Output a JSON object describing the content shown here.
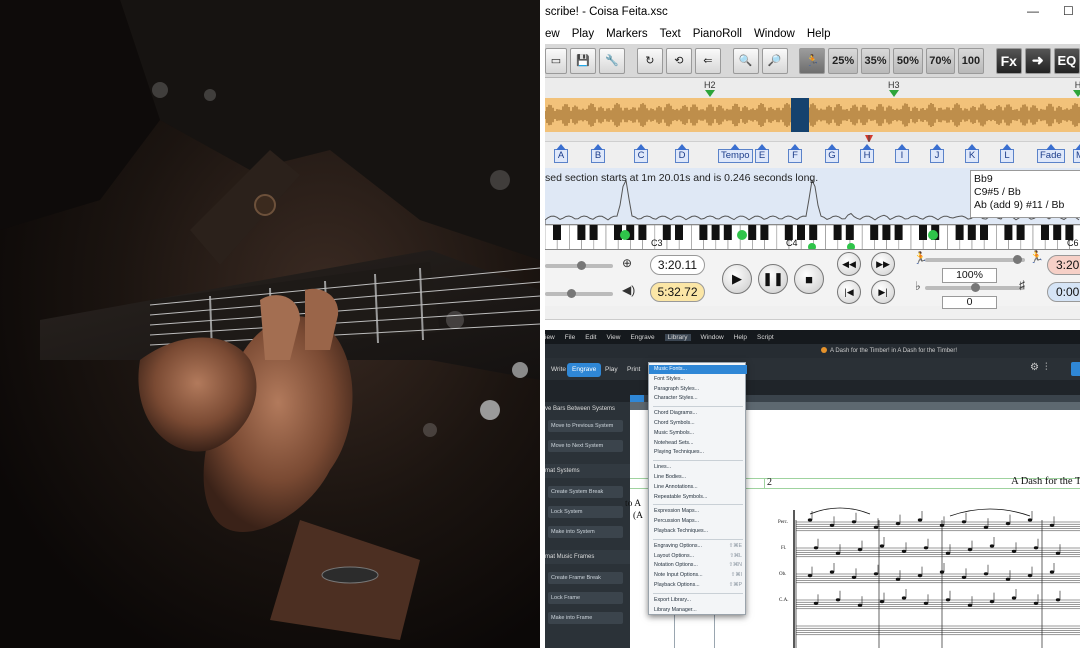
{
  "transcribe": {
    "title": "scribe! - Coisa Feita.xsc",
    "window_controls": {
      "minimize": "—",
      "maximize": "☐"
    },
    "menu": [
      "ew",
      "Play",
      "Markers",
      "Text",
      "PianoRoll",
      "Window",
      "Help"
    ],
    "toolbar": {
      "speed_buttons": [
        "25%",
        "35%",
        "50%",
        "70%",
        "100"
      ],
      "fx": "Fx",
      "eq": "EQ"
    },
    "section_markers": [
      "H2",
      "H3",
      "H"
    ],
    "letter_markers": [
      "A",
      "B",
      "C",
      "D",
      "Tempo",
      "E",
      "F",
      "G",
      "H",
      "I",
      "J",
      "K",
      "L",
      "Fade",
      "M"
    ],
    "info_text": "sed section starts at 1m 20.01s and is 0.246 seconds long.",
    "chords": [
      "Bb9",
      "C9#5 / Bb",
      "Ab (add 9) #11 / Bb"
    ],
    "piano_labels": [
      "C3",
      "C4",
      "C6"
    ],
    "time_current": "3:20.11",
    "time_total": "5:32.72",
    "speed_value": "100%",
    "pitch_value": "0",
    "time_right_1": "3:20",
    "time_right_2": "0:00",
    "icons": [
      "new-icon",
      "save-icon",
      "tune-icon",
      "loop-ab-icon",
      "loop-icon",
      "back-icon",
      "zoom-icon",
      "zoom-fit-icon",
      "runner-icon",
      "play-icon",
      "pause-icon",
      "stop-icon",
      "rewind-icon",
      "fast-forward-icon",
      "skip-start-icon",
      "skip-end-icon",
      "speaker-icon",
      "flat-icon",
      "sharp-icon"
    ]
  },
  "dorico": {
    "menu": [
      "iew",
      "File",
      "Edit",
      "View",
      "Engrave",
      "Library",
      "Window",
      "Help",
      "Script"
    ],
    "active_menu": "Library",
    "title": "A Dash for the Timber! in A Dash for the Timber!",
    "modes": [
      "Write",
      "Engrave",
      "Play",
      "Print"
    ],
    "active_mode": "Engrave",
    "panel": {
      "section1": "ve Bars Between Systems",
      "section1_buttons": [
        "Move to Previous System",
        "Move to Next System"
      ],
      "section2": "mat Systems",
      "section2_buttons": [
        "Create System Break",
        "Lock System",
        "Make into System"
      ],
      "section3": "mat Music Frames",
      "section3_buttons": [
        "Create Frame Break",
        "Lock Frame",
        "Make into Frame"
      ]
    },
    "library_menu": [
      {
        "label": "Music Fonts...",
        "shortcut": ""
      },
      {
        "label": "Font Styles...",
        "shortcut": ""
      },
      {
        "label": "Paragraph Styles...",
        "shortcut": ""
      },
      {
        "label": "Character Styles...",
        "shortcut": ""
      },
      {
        "label": "Chord Diagrams...",
        "shortcut": ""
      },
      {
        "label": "Chord Symbols...",
        "shortcut": ""
      },
      {
        "label": "Music Symbols...",
        "shortcut": ""
      },
      {
        "label": "Notehead Sets...",
        "shortcut": ""
      },
      {
        "label": "Playing Techniques...",
        "shortcut": ""
      },
      {
        "label": "Lines...",
        "shortcut": ""
      },
      {
        "label": "Line Bodies...",
        "shortcut": ""
      },
      {
        "label": "Line Annotations...",
        "shortcut": ""
      },
      {
        "label": "Repeatable Symbols...",
        "shortcut": ""
      },
      {
        "label": "Expression Maps...",
        "shortcut": ""
      },
      {
        "label": "Percussion Maps...",
        "shortcut": ""
      },
      {
        "label": "Playback Techniques...",
        "shortcut": ""
      },
      {
        "label": "Engraving Options...",
        "shortcut": "⇧⌘E"
      },
      {
        "label": "Layout Options...",
        "shortcut": "⇧⌘L"
      },
      {
        "label": "Notation Options...",
        "shortcut": "⇧⌘N"
      },
      {
        "label": "Note Input Options...",
        "shortcut": "⇧⌘I"
      },
      {
        "label": "Playback Options...",
        "shortcut": "⇧⌘P"
      },
      {
        "label": "Export Library...",
        "shortcut": ""
      },
      {
        "label": "Library Manager...",
        "shortcut": ""
      }
    ],
    "score": {
      "title": "A Dash for the Ti",
      "bar_number": "2",
      "left_text_1": "to A",
      "left_text_2": "(A",
      "instruments": [
        "Perc.",
        "Fl.",
        "Ob.",
        "C.A."
      ]
    }
  }
}
